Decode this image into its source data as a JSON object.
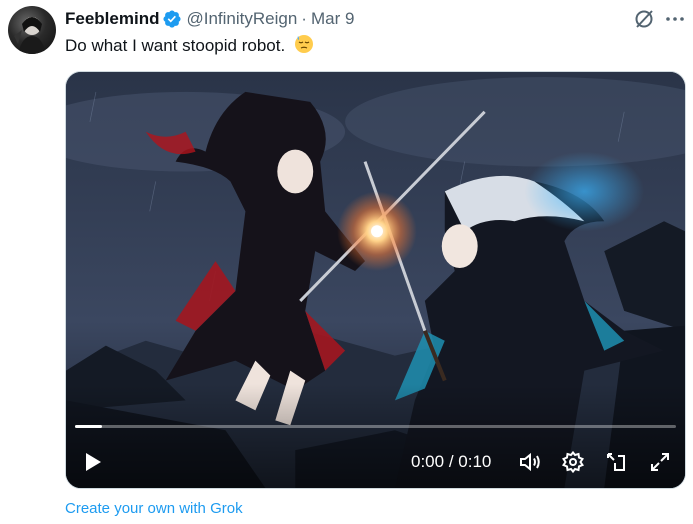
{
  "tweet": {
    "author": {
      "display_name": "Feeblemind",
      "handle": "@InfinityReign",
      "verified": true,
      "avatar_icon": "avatar-image"
    },
    "separator": "·",
    "date": "Mar 9",
    "text": "Do what I want stoopid robot.",
    "text_emoji": "downcast-face-with-sweat-emoji",
    "header_actions": [
      "grok-icon",
      "more-icon"
    ]
  },
  "video": {
    "progress_fraction": 0.045,
    "current_time": "0:00",
    "time_separator": " / ",
    "duration": "0:10",
    "controls": [
      "play-icon",
      "volume-icon",
      "settings-icon",
      "pip-icon",
      "fullscreen-icon"
    ]
  },
  "footer": {
    "link_label": "Create your own with Grok"
  },
  "colors": {
    "link": "#1d9bf0",
    "verified": "#1d9bf0",
    "secondary_text": "#536471",
    "primary_text": "#0f1419"
  }
}
